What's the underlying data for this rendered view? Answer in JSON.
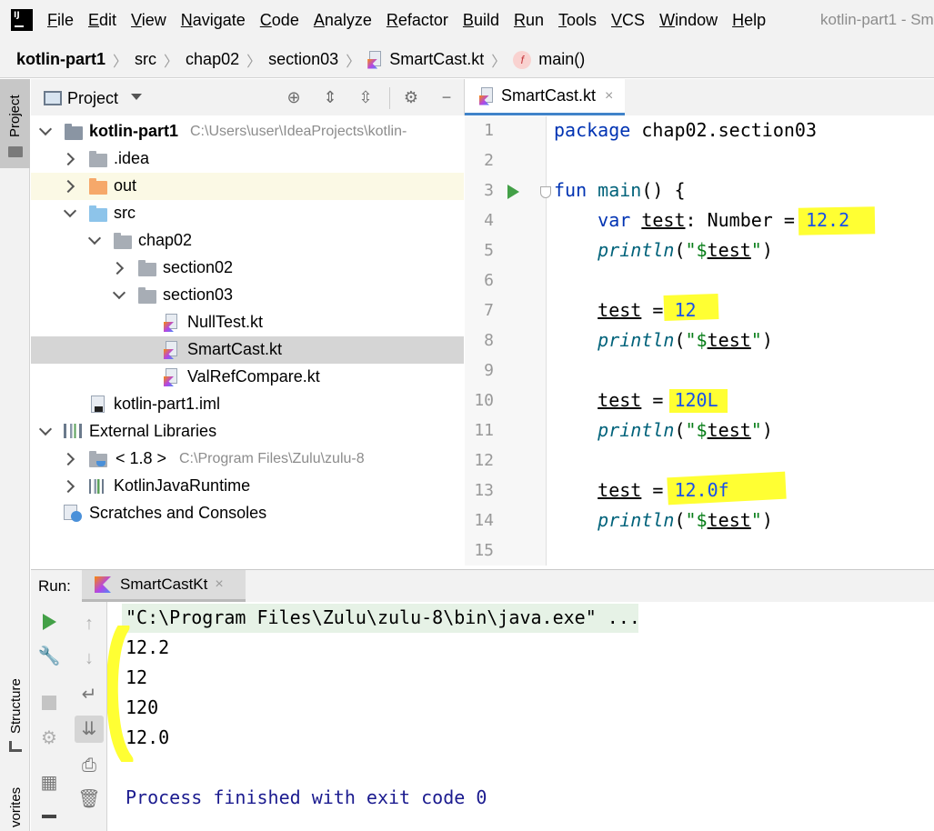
{
  "menubar": {
    "items": [
      "File",
      "Edit",
      "View",
      "Navigate",
      "Code",
      "Analyze",
      "Refactor",
      "Build",
      "Run",
      "Tools",
      "VCS",
      "Window",
      "Help"
    ],
    "window_title": "kotlin-part1 - Sm"
  },
  "breadcrumb": {
    "project": "kotlin-part1",
    "items": [
      "src",
      "chap02",
      "section03",
      "SmartCast.kt",
      "main()"
    ],
    "fn_badge": "f"
  },
  "left_strip": {
    "project_tab": "Project",
    "structure_tab": "Structure",
    "favorites_tab": "vorites"
  },
  "project_panel": {
    "title": "Project",
    "tree": [
      {
        "label": "kotlin-part1",
        "path": "C:\\Users\\user\\IdeaProjects\\kotlin-"
      },
      {
        "label": ".idea"
      },
      {
        "label": "out"
      },
      {
        "label": "src"
      },
      {
        "label": "chap02"
      },
      {
        "label": "section02"
      },
      {
        "label": "section03"
      },
      {
        "label": "NullTest.kt"
      },
      {
        "label": "SmartCast.kt"
      },
      {
        "label": "ValRefCompare.kt"
      },
      {
        "label": "kotlin-part1.iml"
      },
      {
        "label": "External Libraries"
      },
      {
        "label": "< 1.8 >",
        "path": "C:\\Program Files\\Zulu\\zulu-8"
      },
      {
        "label": "KotlinJavaRuntime"
      },
      {
        "label": "Scratches and Consoles"
      }
    ]
  },
  "editor": {
    "tab_label": "SmartCast.kt",
    "tab_close": "×",
    "line_numbers": [
      "1",
      "2",
      "3",
      "4",
      "5",
      "6",
      "7",
      "8",
      "9",
      "10",
      "11",
      "12",
      "13",
      "14",
      "15"
    ],
    "code": {
      "l1_kw": "package",
      "l1_rest": " chap02.section03",
      "l3_kw": "fun",
      "l3_name": " main",
      "l3_rest": "() {",
      "l4_kw": "var ",
      "l4_var": "test",
      "l4_type": ": Number = ",
      "l4_val": "12.2",
      "print_fn": "println",
      "print_open": "(",
      "print_str_open": "\"$",
      "print_var": "test",
      "print_str_close": "\"",
      "print_close": ")",
      "assign_var": "test",
      "assign_eq": " = ",
      "l7_val": "12",
      "l10_val": "120L",
      "l13_val": "12.0f"
    }
  },
  "run_panel": {
    "label": "Run:",
    "tab_label": "SmartCastKt",
    "tab_close": "×",
    "console": {
      "command": "\"C:\\Program Files\\Zulu\\zulu-8\\bin\\java.exe\" ...",
      "outputs": [
        "12.2",
        "12",
        "120",
        "12.0"
      ],
      "finish": "Process finished with exit code 0"
    }
  },
  "colors": {
    "keyword": "#0033b3",
    "function_call": "#00627a",
    "string": "#067d17",
    "highlight": "#ffff33",
    "console_finish": "#1b1b8f",
    "run_green": "#43a047"
  }
}
